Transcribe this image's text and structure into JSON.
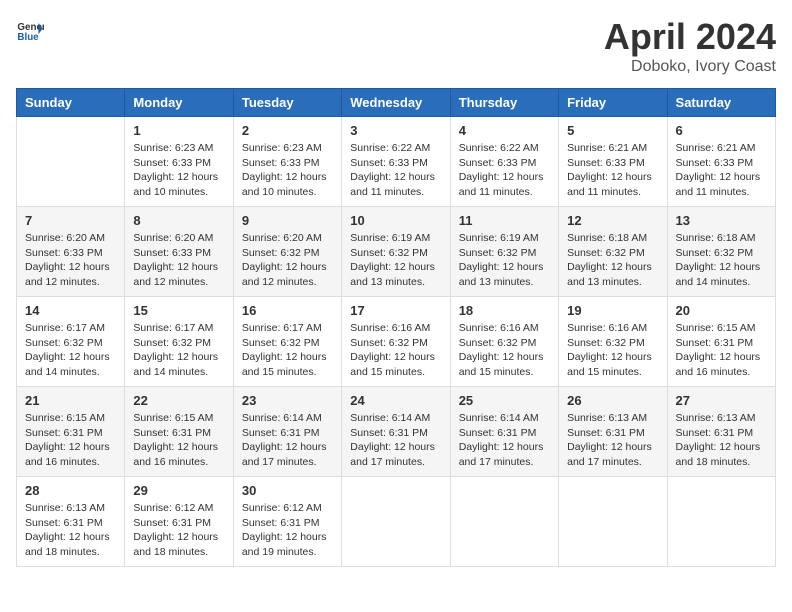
{
  "header": {
    "logo_general": "General",
    "logo_blue": "Blue",
    "title": "April 2024",
    "subtitle": "Doboko, Ivory Coast"
  },
  "days_of_week": [
    "Sunday",
    "Monday",
    "Tuesday",
    "Wednesday",
    "Thursday",
    "Friday",
    "Saturday"
  ],
  "weeks": [
    [
      {
        "day": "",
        "info": ""
      },
      {
        "day": "1",
        "info": "Sunrise: 6:23 AM\nSunset: 6:33 PM\nDaylight: 12 hours\nand 10 minutes."
      },
      {
        "day": "2",
        "info": "Sunrise: 6:23 AM\nSunset: 6:33 PM\nDaylight: 12 hours\nand 10 minutes."
      },
      {
        "day": "3",
        "info": "Sunrise: 6:22 AM\nSunset: 6:33 PM\nDaylight: 12 hours\nand 11 minutes."
      },
      {
        "day": "4",
        "info": "Sunrise: 6:22 AM\nSunset: 6:33 PM\nDaylight: 12 hours\nand 11 minutes."
      },
      {
        "day": "5",
        "info": "Sunrise: 6:21 AM\nSunset: 6:33 PM\nDaylight: 12 hours\nand 11 minutes."
      },
      {
        "day": "6",
        "info": "Sunrise: 6:21 AM\nSunset: 6:33 PM\nDaylight: 12 hours\nand 11 minutes."
      }
    ],
    [
      {
        "day": "7",
        "info": "Sunrise: 6:20 AM\nSunset: 6:33 PM\nDaylight: 12 hours\nand 12 minutes."
      },
      {
        "day": "8",
        "info": "Sunrise: 6:20 AM\nSunset: 6:33 PM\nDaylight: 12 hours\nand 12 minutes."
      },
      {
        "day": "9",
        "info": "Sunrise: 6:20 AM\nSunset: 6:32 PM\nDaylight: 12 hours\nand 12 minutes."
      },
      {
        "day": "10",
        "info": "Sunrise: 6:19 AM\nSunset: 6:32 PM\nDaylight: 12 hours\nand 13 minutes."
      },
      {
        "day": "11",
        "info": "Sunrise: 6:19 AM\nSunset: 6:32 PM\nDaylight: 12 hours\nand 13 minutes."
      },
      {
        "day": "12",
        "info": "Sunrise: 6:18 AM\nSunset: 6:32 PM\nDaylight: 12 hours\nand 13 minutes."
      },
      {
        "day": "13",
        "info": "Sunrise: 6:18 AM\nSunset: 6:32 PM\nDaylight: 12 hours\nand 14 minutes."
      }
    ],
    [
      {
        "day": "14",
        "info": "Sunrise: 6:17 AM\nSunset: 6:32 PM\nDaylight: 12 hours\nand 14 minutes."
      },
      {
        "day": "15",
        "info": "Sunrise: 6:17 AM\nSunset: 6:32 PM\nDaylight: 12 hours\nand 14 minutes."
      },
      {
        "day": "16",
        "info": "Sunrise: 6:17 AM\nSunset: 6:32 PM\nDaylight: 12 hours\nand 15 minutes."
      },
      {
        "day": "17",
        "info": "Sunrise: 6:16 AM\nSunset: 6:32 PM\nDaylight: 12 hours\nand 15 minutes."
      },
      {
        "day": "18",
        "info": "Sunrise: 6:16 AM\nSunset: 6:32 PM\nDaylight: 12 hours\nand 15 minutes."
      },
      {
        "day": "19",
        "info": "Sunrise: 6:16 AM\nSunset: 6:32 PM\nDaylight: 12 hours\nand 15 minutes."
      },
      {
        "day": "20",
        "info": "Sunrise: 6:15 AM\nSunset: 6:31 PM\nDaylight: 12 hours\nand 16 minutes."
      }
    ],
    [
      {
        "day": "21",
        "info": "Sunrise: 6:15 AM\nSunset: 6:31 PM\nDaylight: 12 hours\nand 16 minutes."
      },
      {
        "day": "22",
        "info": "Sunrise: 6:15 AM\nSunset: 6:31 PM\nDaylight: 12 hours\nand 16 minutes."
      },
      {
        "day": "23",
        "info": "Sunrise: 6:14 AM\nSunset: 6:31 PM\nDaylight: 12 hours\nand 17 minutes."
      },
      {
        "day": "24",
        "info": "Sunrise: 6:14 AM\nSunset: 6:31 PM\nDaylight: 12 hours\nand 17 minutes."
      },
      {
        "day": "25",
        "info": "Sunrise: 6:14 AM\nSunset: 6:31 PM\nDaylight: 12 hours\nand 17 minutes."
      },
      {
        "day": "26",
        "info": "Sunrise: 6:13 AM\nSunset: 6:31 PM\nDaylight: 12 hours\nand 17 minutes."
      },
      {
        "day": "27",
        "info": "Sunrise: 6:13 AM\nSunset: 6:31 PM\nDaylight: 12 hours\nand 18 minutes."
      }
    ],
    [
      {
        "day": "28",
        "info": "Sunrise: 6:13 AM\nSunset: 6:31 PM\nDaylight: 12 hours\nand 18 minutes."
      },
      {
        "day": "29",
        "info": "Sunrise: 6:12 AM\nSunset: 6:31 PM\nDaylight: 12 hours\nand 18 minutes."
      },
      {
        "day": "30",
        "info": "Sunrise: 6:12 AM\nSunset: 6:31 PM\nDaylight: 12 hours\nand 19 minutes."
      },
      {
        "day": "",
        "info": ""
      },
      {
        "day": "",
        "info": ""
      },
      {
        "day": "",
        "info": ""
      },
      {
        "day": "",
        "info": ""
      }
    ]
  ]
}
